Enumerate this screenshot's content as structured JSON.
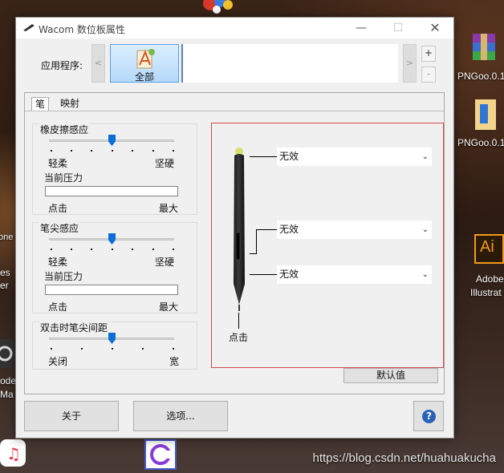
{
  "window": {
    "title": "Wacom 数位板属性",
    "min_glyph": "—",
    "max_glyph": "☐",
    "close_glyph": "✕"
  },
  "app_row": {
    "label": "应用程序:",
    "prev_glyph": "<",
    "next_glyph": ">",
    "selected_app": "全部",
    "add_glyph": "+",
    "remove_glyph": "-"
  },
  "tabs": [
    {
      "label": "笔",
      "selected": true
    },
    {
      "label": "映射",
      "selected": false
    }
  ],
  "eraser_feel": {
    "title": "橡皮擦感应",
    "soft_label": "轻柔",
    "firm_label": "坚硬",
    "current_pressure_label": "当前压力",
    "click_label": "点击",
    "max_label": "最大",
    "level_fraction": 0.5
  },
  "tip_feel": {
    "title": "笔尖感应",
    "soft_label": "轻柔",
    "firm_label": "坚硬",
    "current_pressure_label": "当前压力",
    "click_label": "点击",
    "max_label": "最大",
    "level_fraction": 0.5
  },
  "double_click": {
    "title": "双击时笔尖间距",
    "off_label": "关闭",
    "wide_label": "宽",
    "level_fraction": 0.5
  },
  "pen_buttons": [
    {
      "value": "无效"
    },
    {
      "value": "无效"
    },
    {
      "value": "无效"
    }
  ],
  "tip_label": "点击",
  "default_button": "默认值",
  "about_button": "关于",
  "options_button": "选项...",
  "help_glyph": "?",
  "desktop": {
    "icon1_label": "PNGoo.0.1",
    "icon2_label": "PNGoo.0.1",
    "icon3_line1": "Adobe",
    "icon3_line2": "Illustrat",
    "left_frag1": "one",
    "left_frag2": "es",
    "left_frag3": "er",
    "left_frag4": "ode",
    "left_frag5": "Ma",
    "ai_text": "Ai",
    "watermark": "https://blog.csdn.net/huahuakucha"
  }
}
